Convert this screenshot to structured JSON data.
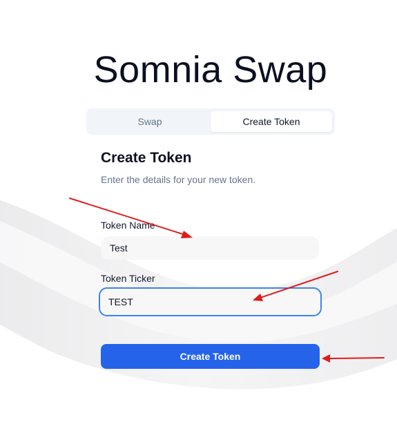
{
  "app": {
    "title": "Somnia Swap"
  },
  "tabs": [
    {
      "label": "Swap",
      "active": false
    },
    {
      "label": "Create Token",
      "active": true
    }
  ],
  "form": {
    "title": "Create Token",
    "subtitle": "Enter the details for your new token.",
    "fields": {
      "name": {
        "label": "Token Name",
        "value": "Test"
      },
      "ticker": {
        "label": "Token Ticker",
        "value": "TEST"
      }
    },
    "submit_label": "Create Token"
  },
  "colors": {
    "accent": "#2563eb",
    "focus_ring": "#3b82f6",
    "annotation_arrow": "#e01b1b"
  }
}
